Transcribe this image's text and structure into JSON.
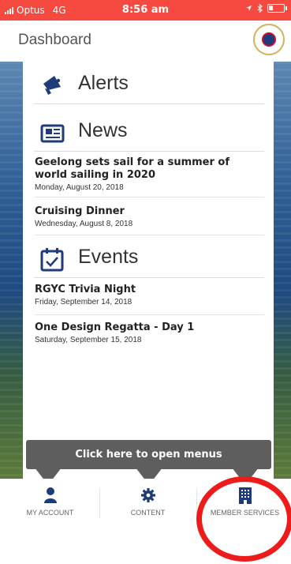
{
  "status_bar": {
    "carrier": "Optus",
    "network": "4G",
    "time": "8:56 am"
  },
  "header": {
    "title": "Dashboard"
  },
  "sections": {
    "alerts": {
      "title": "Alerts"
    },
    "news": {
      "title": "News",
      "items": [
        {
          "title": "Geelong sets sail for a summer of world sailing in 2020",
          "date": "Monday, August 20, 2018"
        },
        {
          "title": "Cruising Dinner",
          "date": "Wednesday, August 8, 2018"
        }
      ]
    },
    "events": {
      "title": "Events",
      "items": [
        {
          "title": "RGYC Trivia Night",
          "date": "Friday, September 14, 2018"
        },
        {
          "title": "One Design Regatta - Day 1",
          "date": "Saturday, September 15, 2018"
        }
      ]
    }
  },
  "tooltip": {
    "text": "Click here to open menus"
  },
  "tabbar": {
    "tabs": [
      {
        "label": "MY ACCOUNT",
        "icon": "user-icon"
      },
      {
        "label": "CONTENT",
        "icon": "gear-icon"
      },
      {
        "label": "MEMBER SERVICES",
        "icon": "building-icon"
      }
    ]
  },
  "colors": {
    "status_bar": "#f6493f",
    "accent": "#1f3b7a",
    "tooltip": "#5e5e5e",
    "highlight": "#ee1b1b"
  }
}
